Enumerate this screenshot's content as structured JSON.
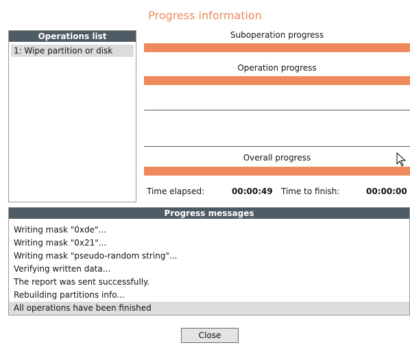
{
  "window": {
    "title": "Progress information"
  },
  "operations": {
    "header": "Operations list",
    "items": [
      {
        "label": "1: Wipe partition or disk"
      }
    ]
  },
  "progress": {
    "suboperation_label": "Suboperation progress",
    "suboperation_fraction": 1.0,
    "operation_label": "Operation progress",
    "operation_fraction": 1.0,
    "overall_label": "Overall progress",
    "overall_fraction": 1.0,
    "time_elapsed_label": "Time elapsed:",
    "time_elapsed_value": "00:00:49",
    "time_to_finish_label": "Time to finish:",
    "time_to_finish_value": "00:00:00"
  },
  "messages": {
    "header": "Progress messages",
    "items": [
      "Writing mask \"0xde\"...",
      "Writing mask \"0x21\"...",
      "Writing mask \"pseudo-random string\"...",
      "Verifying written data...",
      "The report was sent successfully.",
      "Rebuilding partitions info...",
      "All operations have been finished"
    ],
    "selected_index": 6
  },
  "buttons": {
    "close_label": "Close"
  },
  "colors": {
    "accent": "#f08a5d",
    "header_bg": "#4d5b65",
    "selection_bg": "#dcdcdc"
  }
}
